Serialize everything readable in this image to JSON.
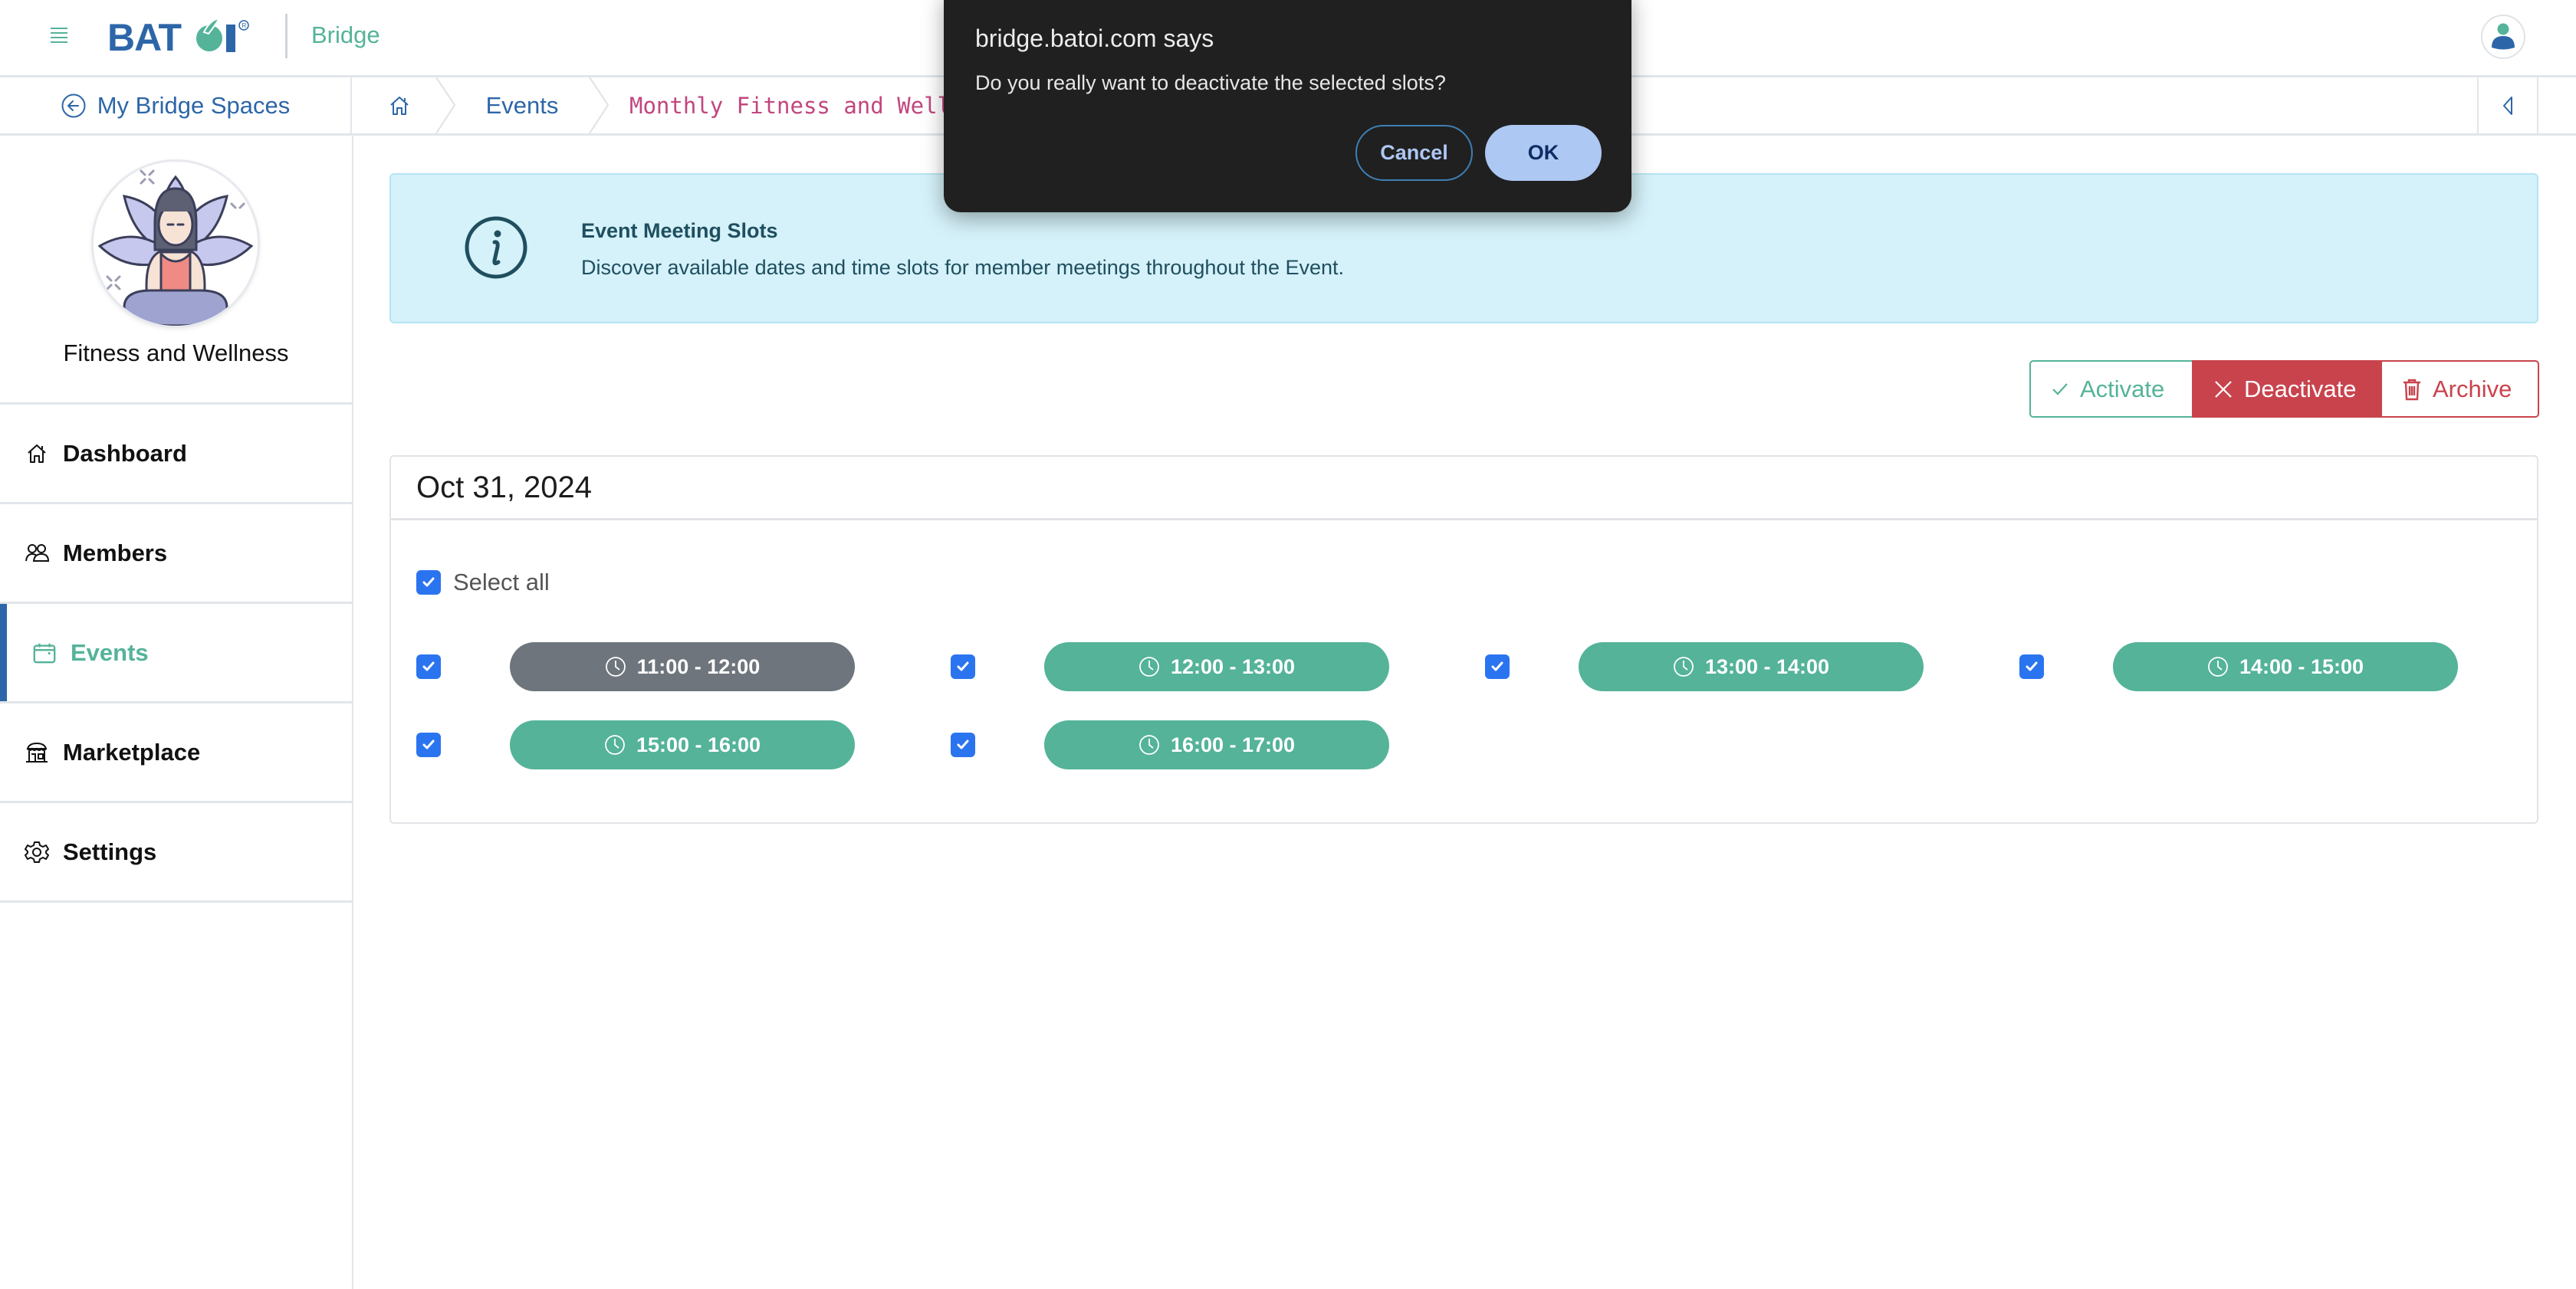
{
  "header": {
    "brand": "BATOI",
    "app_name": "Bridge",
    "menu_icon": "hamburger-icon",
    "user_icon": "user-avatar-icon"
  },
  "breadcrumb": {
    "back_label": "My Bridge Spaces",
    "back_icon": "arrow-left-circle-icon",
    "home_icon": "home-icon",
    "items": [
      "Events",
      "Monthly Fitness and Well"
    ],
    "collapse_icon": "triangle-left-icon"
  },
  "sidebar": {
    "space_name": "Fitness and Wellness",
    "items": [
      {
        "label": "Dashboard",
        "icon": "home-icon",
        "active": false
      },
      {
        "label": "Members",
        "icon": "users-icon",
        "active": false
      },
      {
        "label": "Events",
        "icon": "calendar-icon",
        "active": true
      },
      {
        "label": "Marketplace",
        "icon": "store-icon",
        "active": false
      },
      {
        "label": "Settings",
        "icon": "gear-icon",
        "active": false
      }
    ]
  },
  "info": {
    "title": "Event Meeting Slots",
    "text": "Discover available dates and time slots for member meetings throughout the Event."
  },
  "actions": {
    "activate": "Activate",
    "deactivate": "Deactivate",
    "archive": "Archive"
  },
  "date_card": {
    "date": "Oct 31, 2024",
    "select_all_label": "Select all",
    "select_all_checked": true,
    "slots": [
      {
        "time": "11:00 - 12:00",
        "checked": true,
        "status": "inactive"
      },
      {
        "time": "12:00 - 13:00",
        "checked": true,
        "status": "active"
      },
      {
        "time": "13:00 - 14:00",
        "checked": true,
        "status": "active"
      },
      {
        "time": "14:00 - 15:00",
        "checked": true,
        "status": "active"
      },
      {
        "time": "15:00 - 16:00",
        "checked": true,
        "status": "active"
      },
      {
        "time": "16:00 - 17:00",
        "checked": true,
        "status": "active"
      }
    ]
  },
  "dialog": {
    "title": "bridge.batoi.com says",
    "message": "Do you really want to deactivate the selected slots?",
    "cancel_label": "Cancel",
    "ok_label": "OK"
  },
  "colors": {
    "brand_blue": "#2d66a8",
    "brand_green": "#54b399",
    "danger": "#c9434d",
    "checkbox": "#2b74f0",
    "inactive_slot": "#6e757c",
    "info_bg": "#d5f1fa",
    "dialog_bg": "#202020"
  }
}
